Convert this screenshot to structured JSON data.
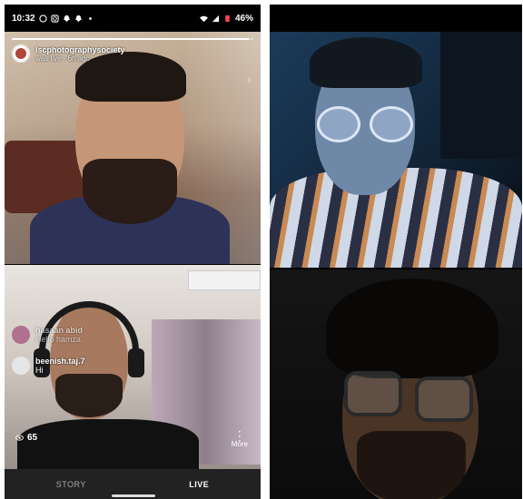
{
  "status_bar": {
    "time": "10:32",
    "battery": "46%"
  },
  "live": {
    "host_name": "lscphotographysociety",
    "host_subtitle": "was live · 6h ago",
    "progress_fraction": 0.98,
    "viewers": "65",
    "more_label": "More",
    "comments": [
      {
        "user": "hasaan abid",
        "text": "Hello hamza",
        "avatar_color": "#b0708f",
        "faded": true
      },
      {
        "user": "beenish.taj.7",
        "text": "Hi",
        "avatar_color": "#e6e6e6",
        "faded": false
      }
    ],
    "tabs": [
      {
        "label": "STORY",
        "active": false
      },
      {
        "label": "LIVE",
        "active": true
      }
    ]
  },
  "icons": [
    "whatsapp-icon",
    "instagram-icon",
    "snapchat-icon",
    "wifi-icon",
    "signal-icon",
    "battery-icon",
    "eye-icon",
    "more-vertical-icon",
    "chevron-right-icon"
  ],
  "colors": {
    "tile_top_left": "#a98f78",
    "tile_bottom_left": "#cfc7bf",
    "tile_top_right": "#13283d",
    "tile_bottom_right": "#0b0b0b",
    "battery_low": "#ff4444"
  }
}
